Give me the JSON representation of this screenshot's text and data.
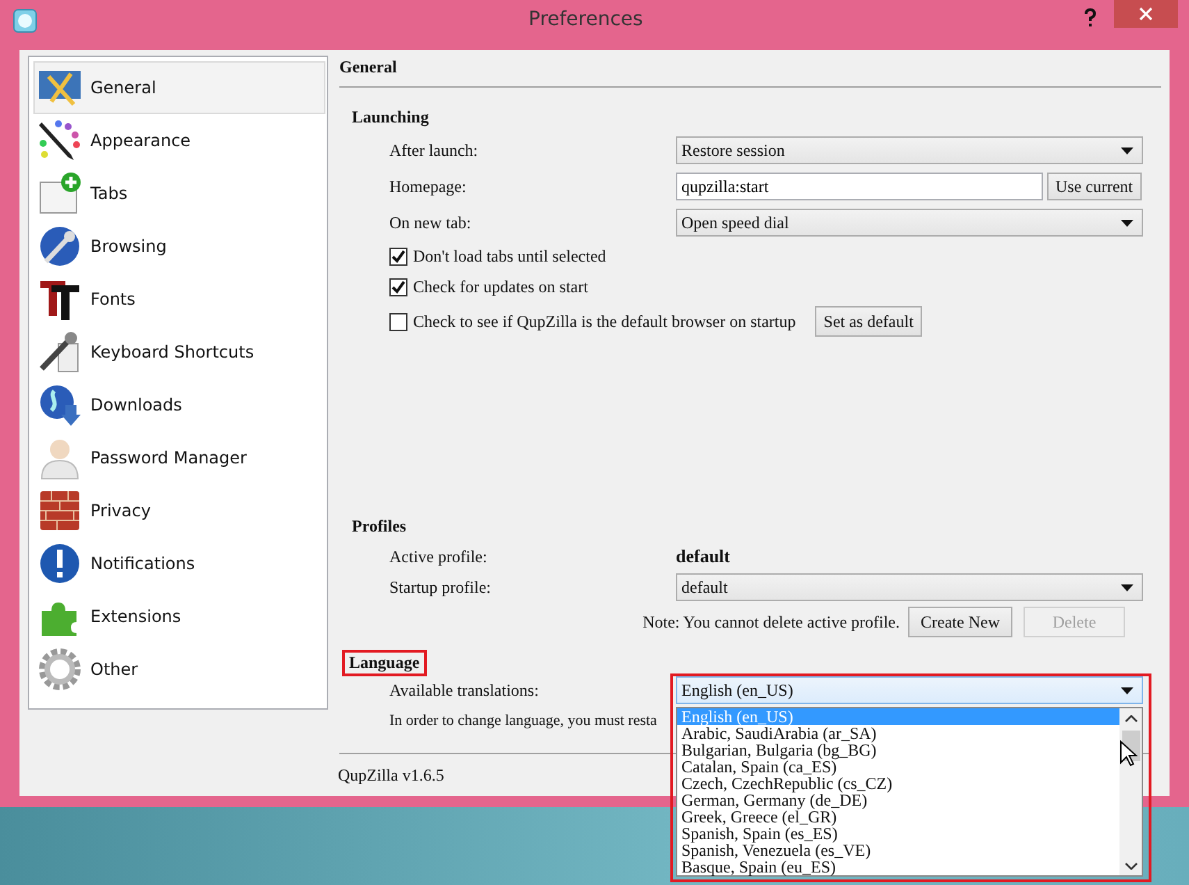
{
  "window": {
    "title": "Preferences"
  },
  "sidebar": {
    "items": [
      {
        "label": "General",
        "selected": true
      },
      {
        "label": "Appearance",
        "selected": false
      },
      {
        "label": "Tabs",
        "selected": false
      },
      {
        "label": "Browsing",
        "selected": false
      },
      {
        "label": "Fonts",
        "selected": false
      },
      {
        "label": "Keyboard Shortcuts",
        "selected": false
      },
      {
        "label": "Downloads",
        "selected": false
      },
      {
        "label": "Password Manager",
        "selected": false
      },
      {
        "label": "Privacy",
        "selected": false
      },
      {
        "label": "Notifications",
        "selected": false
      },
      {
        "label": "Extensions",
        "selected": false
      },
      {
        "label": "Other",
        "selected": false
      }
    ]
  },
  "page_title": "General",
  "launching": {
    "heading": "Launching",
    "rows": [
      {
        "kind": "select",
        "label": "After launch:",
        "value": "Restore session"
      },
      {
        "kind": "input",
        "label": "Homepage:",
        "value": "qupzilla:start",
        "button": "Use current"
      },
      {
        "kind": "select",
        "label": "On new tab:",
        "value": "Open speed dial"
      }
    ],
    "checkboxes": [
      {
        "label": "Don't load tabs until selected",
        "checked": true
      },
      {
        "label": "Check for updates on start",
        "checked": true
      },
      {
        "label": "Check to see if QupZilla is the default browser on startup",
        "checked": false,
        "button": "Set as default"
      }
    ]
  },
  "profiles": {
    "heading": "Profiles",
    "active_label": "Active profile:",
    "active_value": "default",
    "startup_label": "Startup profile:",
    "startup_value": "default",
    "note": "Note: You cannot delete active profile.",
    "buttons": [
      {
        "label": "Create New",
        "disabled": false
      },
      {
        "label": "Delete",
        "disabled": true
      }
    ]
  },
  "language": {
    "heading": "Language",
    "heading_highlighted": true,
    "translations_label": "Available translations:",
    "value": "English (en_US)",
    "note": "In order to change language, you must resta",
    "dropdown_highlighted": true,
    "options": [
      {
        "label": "English (en_US)",
        "selected": true
      },
      {
        "label": "Arabic, SaudiArabia (ar_SA)",
        "selected": false
      },
      {
        "label": "Bulgarian, Bulgaria (bg_BG)",
        "selected": false
      },
      {
        "label": "Catalan, Spain (ca_ES)",
        "selected": false
      },
      {
        "label": "Czech, CzechRepublic (cs_CZ)",
        "selected": false
      },
      {
        "label": "German, Germany (de_DE)",
        "selected": false
      },
      {
        "label": "Greek, Greece (el_GR)",
        "selected": false
      },
      {
        "label": "Spanish, Spain (es_ES)",
        "selected": false
      },
      {
        "label": "Spanish, Venezuela (es_VE)",
        "selected": false
      },
      {
        "label": "Basque, Spain (eu_ES)",
        "selected": false
      }
    ]
  },
  "footer": {
    "version": "QupZilla v1.6.5"
  }
}
